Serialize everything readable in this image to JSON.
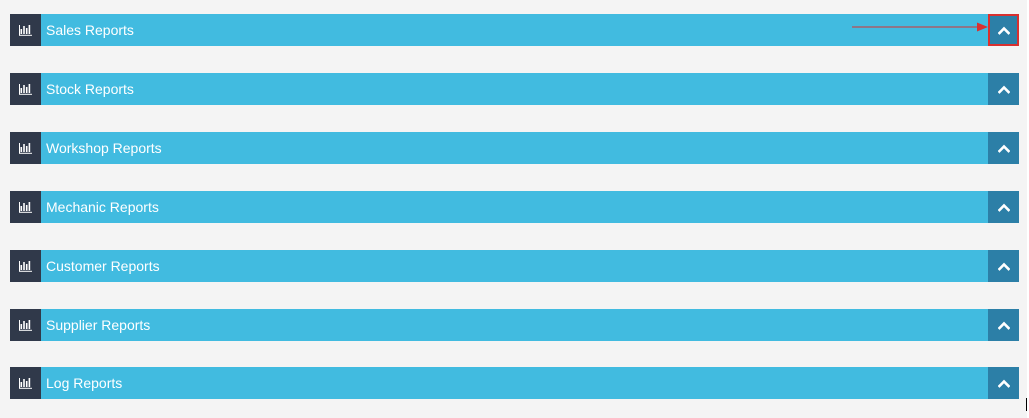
{
  "colors": {
    "panel_bg": "#41bbe0",
    "icon_bg": "#30394a",
    "toggle_bg": "#2c7fa7",
    "highlight_border": "#d9302f",
    "page_bg": "#f4f4f4"
  },
  "panels": [
    {
      "title": "Sales Reports",
      "icon": "bar-chart-icon",
      "toggle_icon": "chevron-up-icon"
    },
    {
      "title": "Stock Reports",
      "icon": "bar-chart-icon",
      "toggle_icon": "chevron-up-icon"
    },
    {
      "title": "Workshop Reports",
      "icon": "bar-chart-icon",
      "toggle_icon": "chevron-up-icon"
    },
    {
      "title": "Mechanic Reports",
      "icon": "bar-chart-icon",
      "toggle_icon": "chevron-up-icon"
    },
    {
      "title": "Customer Reports",
      "icon": "bar-chart-icon",
      "toggle_icon": "chevron-up-icon"
    },
    {
      "title": "Supplier Reports",
      "icon": "bar-chart-icon",
      "toggle_icon": "chevron-up-icon"
    },
    {
      "title": "Log Reports",
      "icon": "bar-chart-icon",
      "toggle_icon": "chevron-up-icon"
    }
  ],
  "annotation": {
    "type": "arrow",
    "target": "Sales Reports collapse button"
  }
}
